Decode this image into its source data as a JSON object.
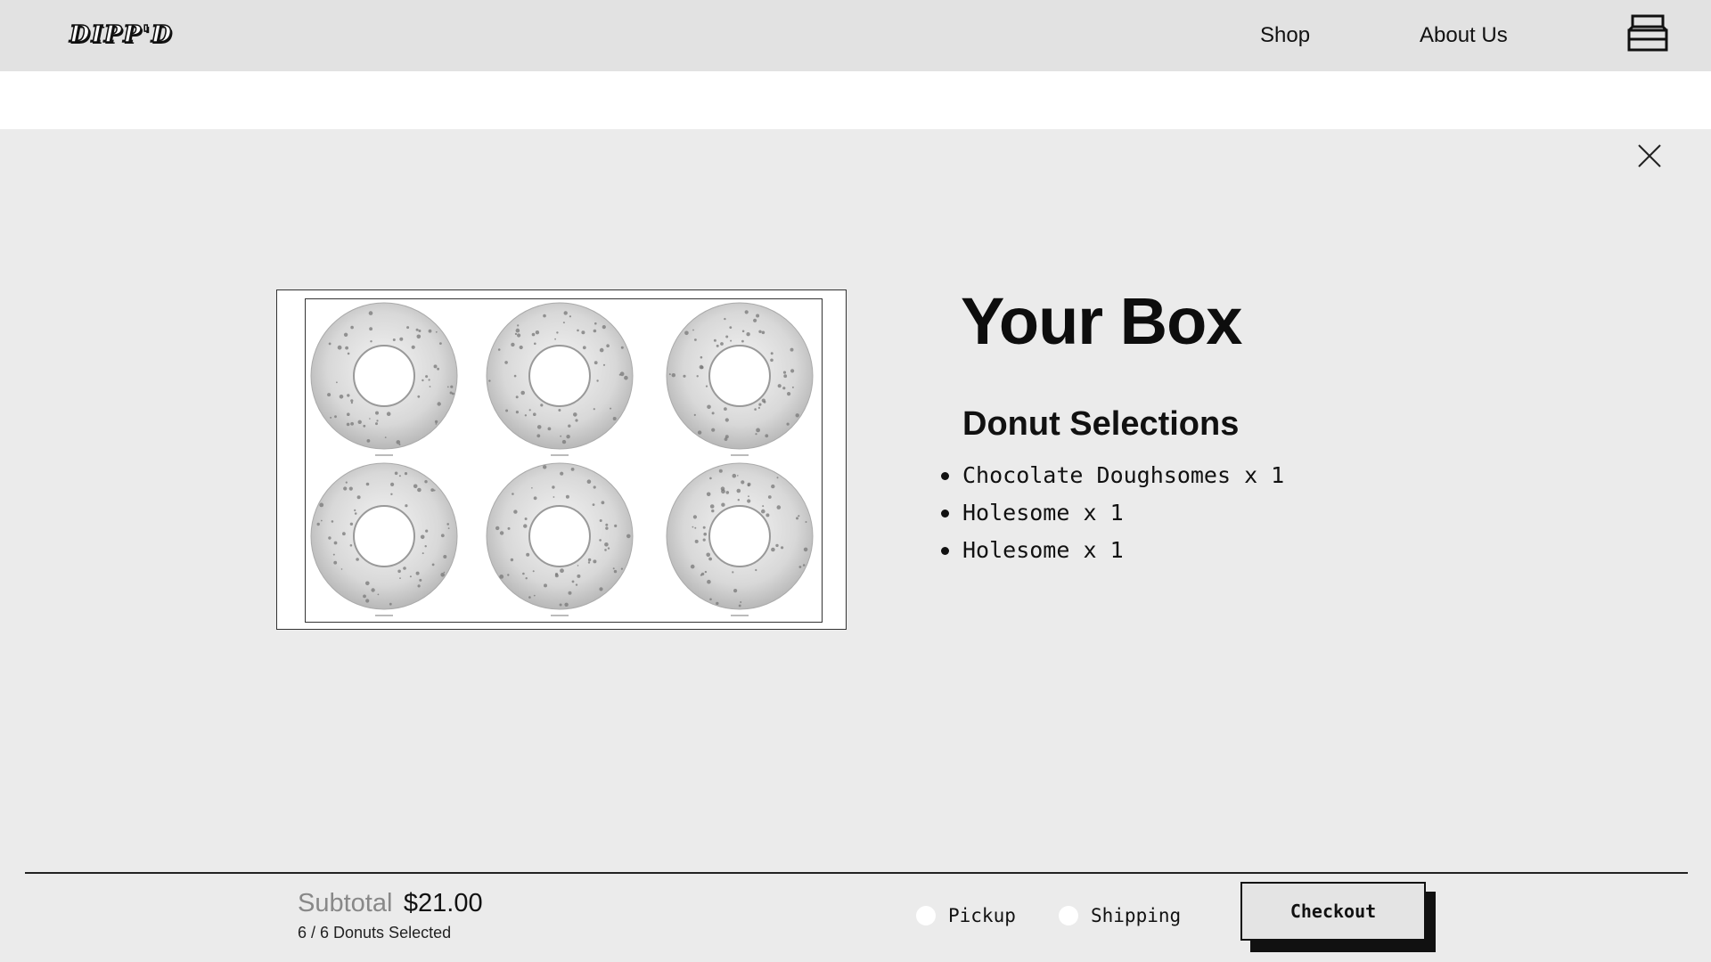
{
  "header": {
    "logo_text": "DIPP'D",
    "nav": {
      "shop_label": "Shop",
      "about_label": "About Us"
    },
    "cart_icon": "donut-box-icon"
  },
  "modal": {
    "close_icon": "close-icon",
    "title": "Your Box",
    "selections_heading": "Donut Selections",
    "selections": [
      "Chocolate Doughsomes x 1",
      "Holesome x 1",
      "Holesome x 1"
    ],
    "box_image": {
      "donut_count": 6
    }
  },
  "footer": {
    "subtotal_label": "Subtotal",
    "subtotal_value": "$21.00",
    "donut_count_text": "6 / 6 Donuts Selected",
    "pickup_label": "Pickup",
    "shipping_label": "Shipping",
    "checkout_label": "Checkout"
  }
}
